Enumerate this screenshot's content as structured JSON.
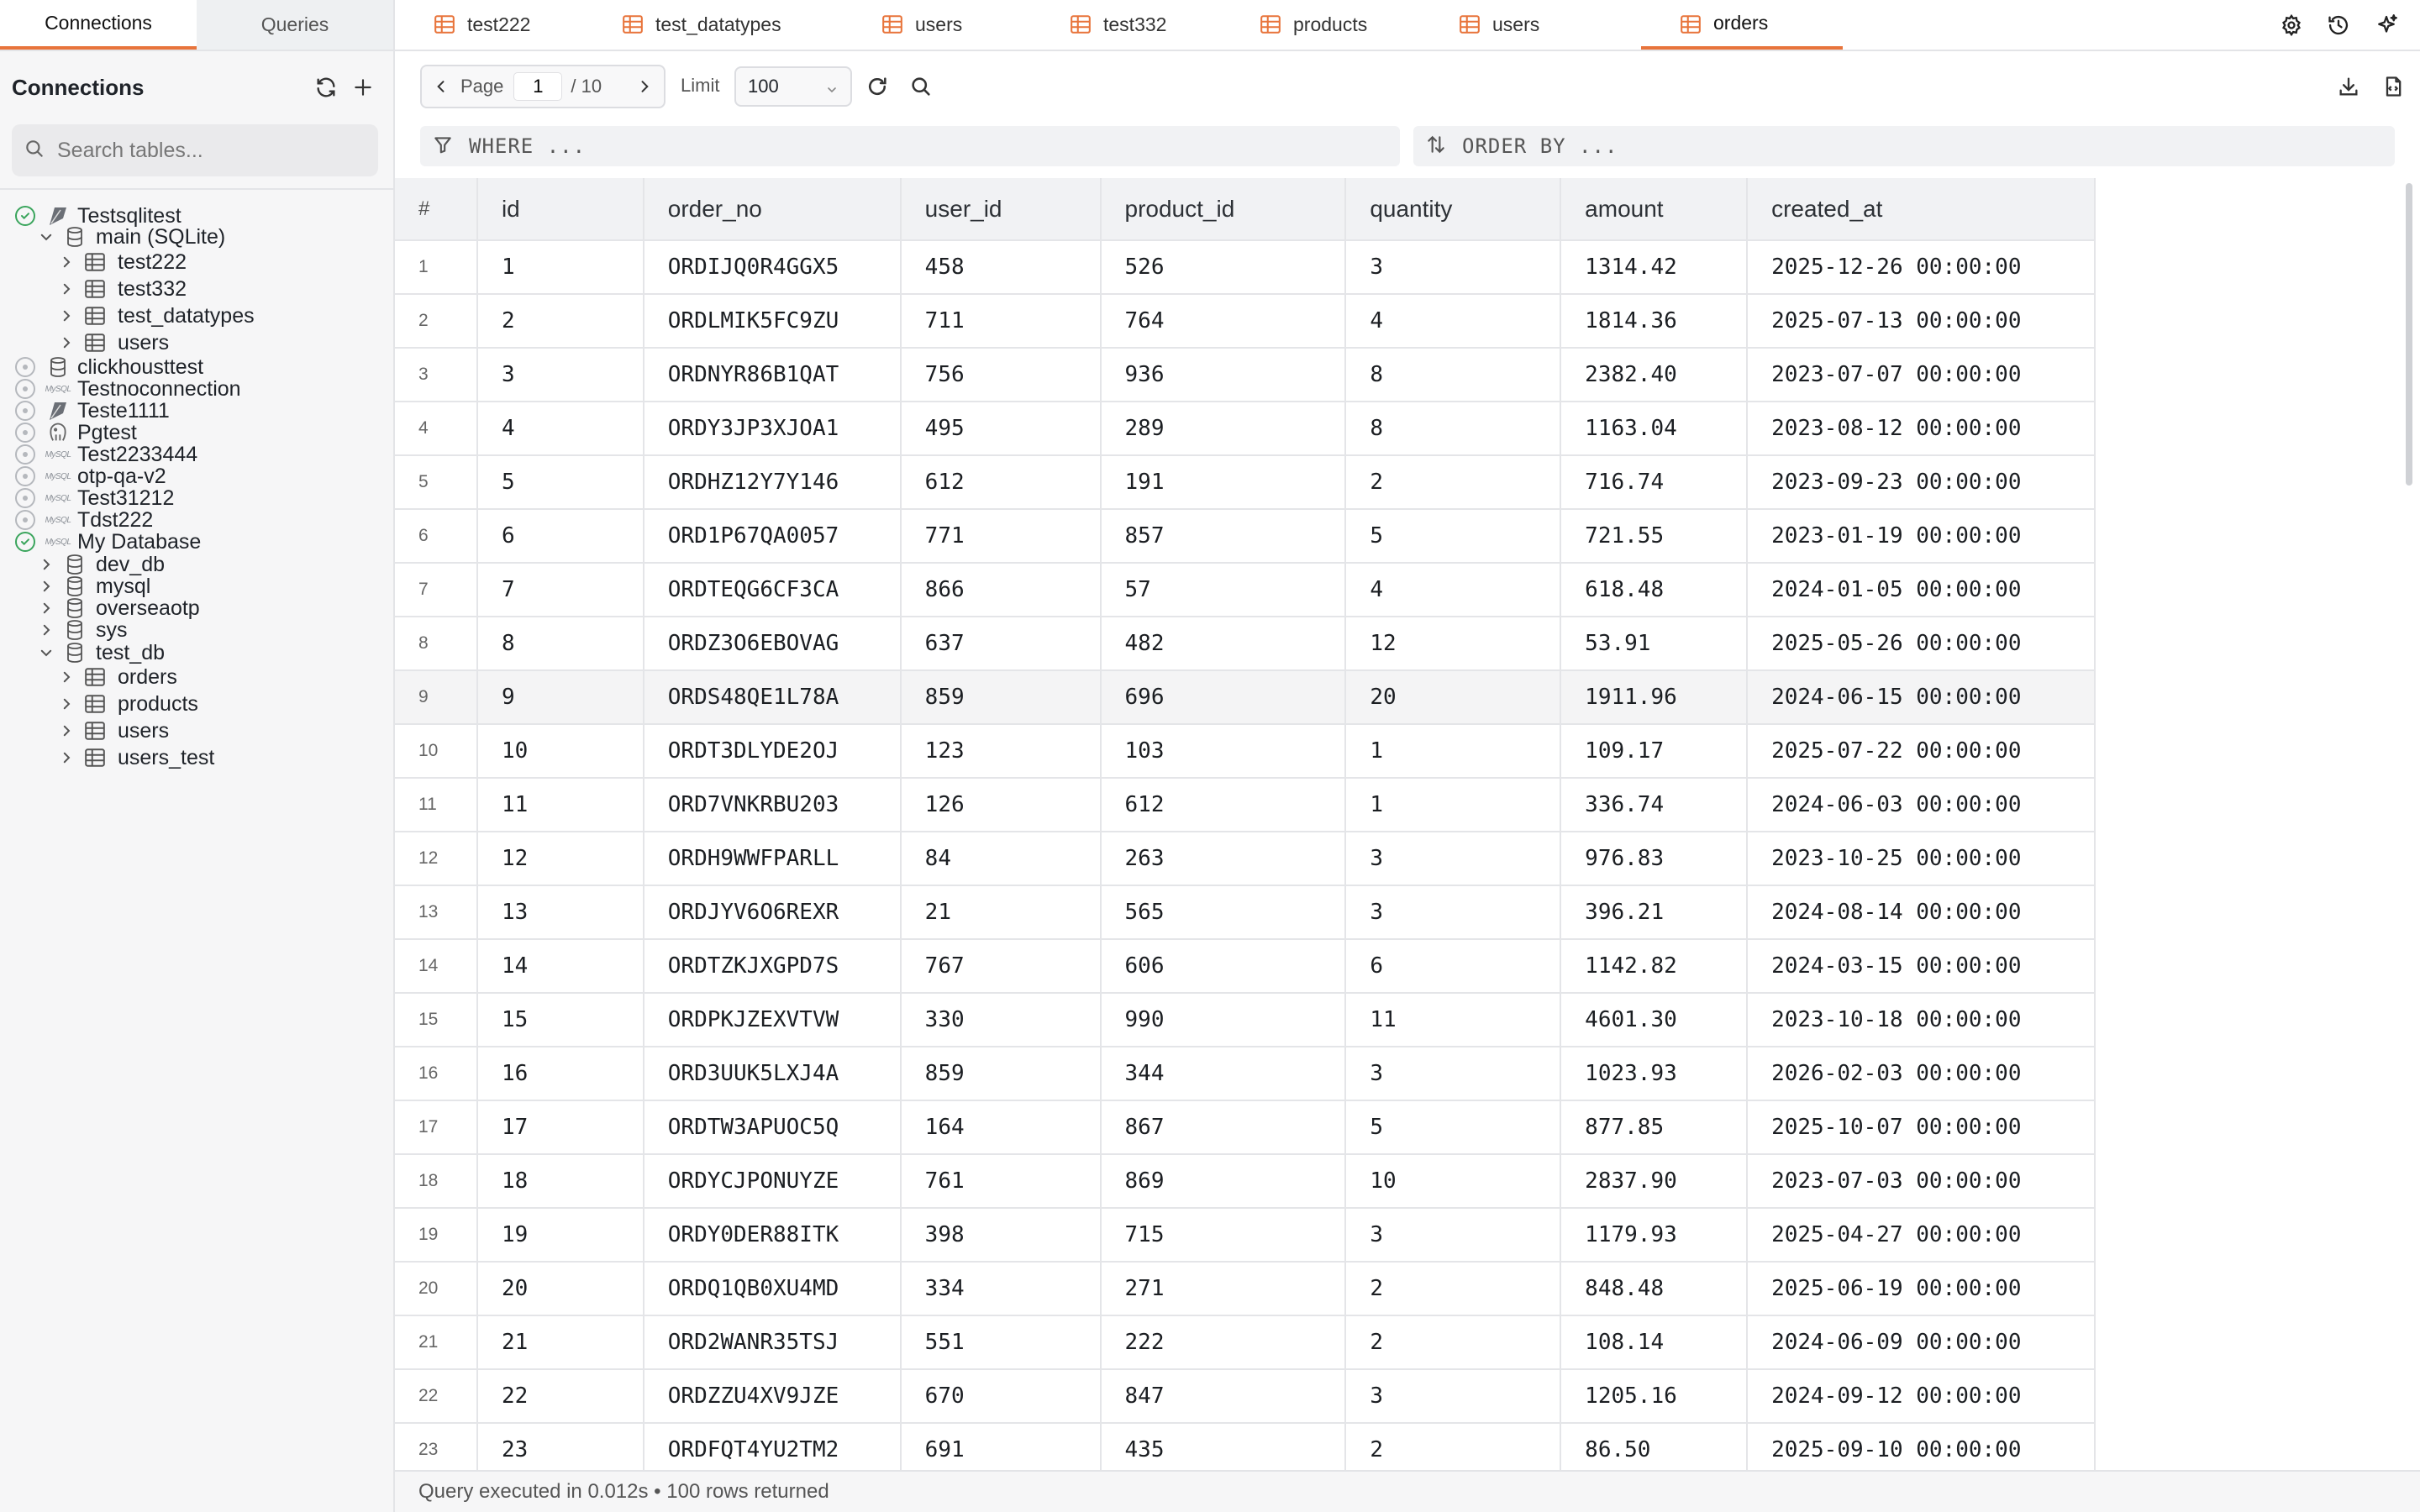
{
  "sidebar": {
    "tabs": [
      "Connections",
      "Queries"
    ],
    "header_title": "Connections",
    "search_placeholder": "Search tables...",
    "tree": [
      {
        "label": "Testsqlitest",
        "kind": "connection",
        "status": "connected",
        "icon": "sqlite-feather-icon"
      },
      {
        "label": "main (SQLite)",
        "kind": "database",
        "expanded": true
      },
      {
        "label": "test222",
        "kind": "table"
      },
      {
        "label": "test332",
        "kind": "table"
      },
      {
        "label": "test_datatypes",
        "kind": "table"
      },
      {
        "label": "users",
        "kind": "table"
      },
      {
        "label": "clickhousttest",
        "kind": "connection",
        "status": "disconnected",
        "icon": "database-icon"
      },
      {
        "label": "Testnoconnection",
        "kind": "connection",
        "status": "disconnected",
        "icon": "mysql-icon"
      },
      {
        "label": "Teste1111",
        "kind": "connection",
        "status": "disconnected",
        "icon": "sqlite-feather-icon"
      },
      {
        "label": "Pgtest",
        "kind": "connection",
        "status": "disconnected",
        "icon": "postgres-elephant-icon"
      },
      {
        "label": "Test2233444",
        "kind": "connection",
        "status": "disconnected",
        "icon": "mysql-icon"
      },
      {
        "label": "otp-qa-v2",
        "kind": "connection",
        "status": "disconnected",
        "icon": "mysql-icon"
      },
      {
        "label": "Test31212",
        "kind": "connection",
        "status": "disconnected",
        "icon": "mysql-icon"
      },
      {
        "label": "Tdst222",
        "kind": "connection",
        "status": "disconnected",
        "icon": "mysql-icon"
      },
      {
        "label": "My Database",
        "kind": "connection",
        "status": "connected",
        "icon": "mysql-icon"
      },
      {
        "label": "dev_db",
        "kind": "database",
        "expanded": false
      },
      {
        "label": "mysql",
        "kind": "database",
        "expanded": false
      },
      {
        "label": "overseaotp",
        "kind": "database",
        "expanded": false
      },
      {
        "label": "sys",
        "kind": "database",
        "expanded": false
      },
      {
        "label": "test_db",
        "kind": "database",
        "expanded": true
      },
      {
        "label": "orders",
        "kind": "table"
      },
      {
        "label": "products",
        "kind": "table"
      },
      {
        "label": "users",
        "kind": "table"
      },
      {
        "label": "users_test",
        "kind": "table"
      }
    ]
  },
  "tabs": [
    {
      "label": "test222",
      "active": false
    },
    {
      "label": "test_datatypes",
      "active": false
    },
    {
      "label": "users",
      "active": false
    },
    {
      "label": "test332",
      "active": false
    },
    {
      "label": "products",
      "active": false
    },
    {
      "label": "users",
      "active": false
    },
    {
      "label": "orders",
      "active": true
    }
  ],
  "toolbar": {
    "page_label": "Page",
    "page_value": "1",
    "page_total": "/ 10",
    "limit_label": "Limit",
    "limit_value": "100"
  },
  "filters": {
    "where_placeholder": "WHERE ...",
    "orderby_placeholder": "ORDER BY ..."
  },
  "grid": {
    "columns": [
      "#",
      "id",
      "order_no",
      "user_id",
      "product_id",
      "quantity",
      "amount",
      "created_at"
    ],
    "highlighted_row": 9,
    "rows": [
      [
        "1",
        "1",
        "ORDIJQ0R4GGX5",
        "458",
        "526",
        "3",
        "1314.42",
        "2025-12-26 00:00:00"
      ],
      [
        "2",
        "2",
        "ORDLMIK5FC9ZU",
        "711",
        "764",
        "4",
        "1814.36",
        "2025-07-13 00:00:00"
      ],
      [
        "3",
        "3",
        "ORDNYR86B1QAT",
        "756",
        "936",
        "8",
        "2382.40",
        "2023-07-07 00:00:00"
      ],
      [
        "4",
        "4",
        "ORDY3JP3XJOA1",
        "495",
        "289",
        "8",
        "1163.04",
        "2023-08-12 00:00:00"
      ],
      [
        "5",
        "5",
        "ORDHZ12Y7Y146",
        "612",
        "191",
        "2",
        "716.74",
        "2023-09-23 00:00:00"
      ],
      [
        "6",
        "6",
        "ORD1P67QA0057",
        "771",
        "857",
        "5",
        "721.55",
        "2023-01-19 00:00:00"
      ],
      [
        "7",
        "7",
        "ORDTEQG6CF3CA",
        "866",
        "57",
        "4",
        "618.48",
        "2024-01-05 00:00:00"
      ],
      [
        "8",
        "8",
        "ORDZ3O6EBOVAG",
        "637",
        "482",
        "12",
        "53.91",
        "2025-05-26 00:00:00"
      ],
      [
        "9",
        "9",
        "ORDS48QE1L78A",
        "859",
        "696",
        "20",
        "1911.96",
        "2024-06-15 00:00:00"
      ],
      [
        "10",
        "10",
        "ORDT3DLYDE2OJ",
        "123",
        "103",
        "1",
        "109.17",
        "2025-07-22 00:00:00"
      ],
      [
        "11",
        "11",
        "ORD7VNKRBU203",
        "126",
        "612",
        "1",
        "336.74",
        "2024-06-03 00:00:00"
      ],
      [
        "12",
        "12",
        "ORDH9WWFPARLL",
        "84",
        "263",
        "3",
        "976.83",
        "2023-10-25 00:00:00"
      ],
      [
        "13",
        "13",
        "ORDJYV6O6REXR",
        "21",
        "565",
        "3",
        "396.21",
        "2024-08-14 00:00:00"
      ],
      [
        "14",
        "14",
        "ORDTZKJXGPD7S",
        "767",
        "606",
        "6",
        "1142.82",
        "2024-03-15 00:00:00"
      ],
      [
        "15",
        "15",
        "ORDPKJZEXVTVW",
        "330",
        "990",
        "11",
        "4601.30",
        "2023-10-18 00:00:00"
      ],
      [
        "16",
        "16",
        "ORD3UUK5LXJ4A",
        "859",
        "344",
        "3",
        "1023.93",
        "2026-02-03 00:00:00"
      ],
      [
        "17",
        "17",
        "ORDTW3APUOC5Q",
        "164",
        "867",
        "5",
        "877.85",
        "2025-10-07 00:00:00"
      ],
      [
        "18",
        "18",
        "ORDYCJPONUYZE",
        "761",
        "869",
        "10",
        "2837.90",
        "2023-07-03 00:00:00"
      ],
      [
        "19",
        "19",
        "ORDY0DER88ITK",
        "398",
        "715",
        "3",
        "1179.93",
        "2025-04-27 00:00:00"
      ],
      [
        "20",
        "20",
        "ORDQ1QB0XU4MD",
        "334",
        "271",
        "2",
        "848.48",
        "2025-06-19 00:00:00"
      ],
      [
        "21",
        "21",
        "ORD2WANR35TSJ",
        "551",
        "222",
        "2",
        "108.14",
        "2024-06-09 00:00:00"
      ],
      [
        "22",
        "22",
        "ORDZZU4XV9JZE",
        "670",
        "847",
        "3",
        "1205.16",
        "2024-09-12 00:00:00"
      ],
      [
        "23",
        "23",
        "ORDFQT4YU2TM2",
        "691",
        "435",
        "2",
        "86.50",
        "2025-09-10 00:00:00"
      ]
    ]
  },
  "status_bar": {
    "text": "Query executed in 0.012s • 100 rows returned"
  },
  "colors": {
    "accent": "#e8743b",
    "connected": "#3ba55d",
    "header_bg": "#f1f2f4"
  }
}
